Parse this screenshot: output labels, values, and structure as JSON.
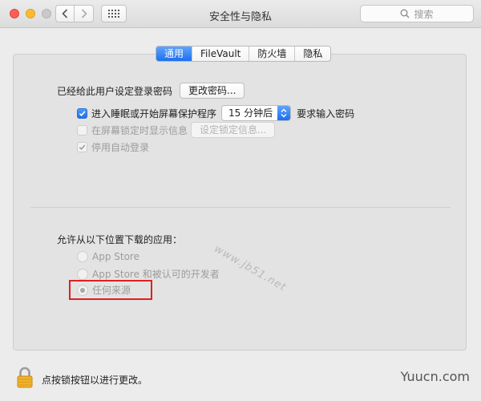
{
  "window": {
    "title": "安全性与隐私",
    "search_placeholder": "搜索"
  },
  "tabs": [
    {
      "label": "通用",
      "active": true
    },
    {
      "label": "FileVault",
      "active": false
    },
    {
      "label": "防火墙",
      "active": false
    },
    {
      "label": "隐私",
      "active": false
    }
  ],
  "general": {
    "password_set_label": "已经给此用户设定登录密码",
    "change_password_button": "更改密码...",
    "require_password": {
      "checked": true,
      "label": "进入睡眠或开始屏幕保护程序",
      "delay_value": "15 分钟后",
      "suffix": "要求输入密码"
    },
    "show_message": {
      "checked": false,
      "enabled": false,
      "label": "在屏幕锁定时显示信息",
      "button": "设定锁定信息..."
    },
    "disable_auto_login": {
      "checked": true,
      "enabled": false,
      "label": "停用自动登录"
    }
  },
  "downloads": {
    "heading": "允许从以下位置下载的应用：",
    "options": [
      {
        "label": "App Store",
        "selected": false
      },
      {
        "label": "App Store 和被认可的开发者",
        "selected": false
      },
      {
        "label": "任何来源",
        "selected": true
      }
    ]
  },
  "watermark": "www.jb51.net",
  "footer": {
    "lock_text": "点按锁按钮以进行更改。",
    "site_mark": "Yuucn.com"
  },
  "colors": {
    "accent": "#1d6ff0",
    "highlight": "#e02020"
  }
}
